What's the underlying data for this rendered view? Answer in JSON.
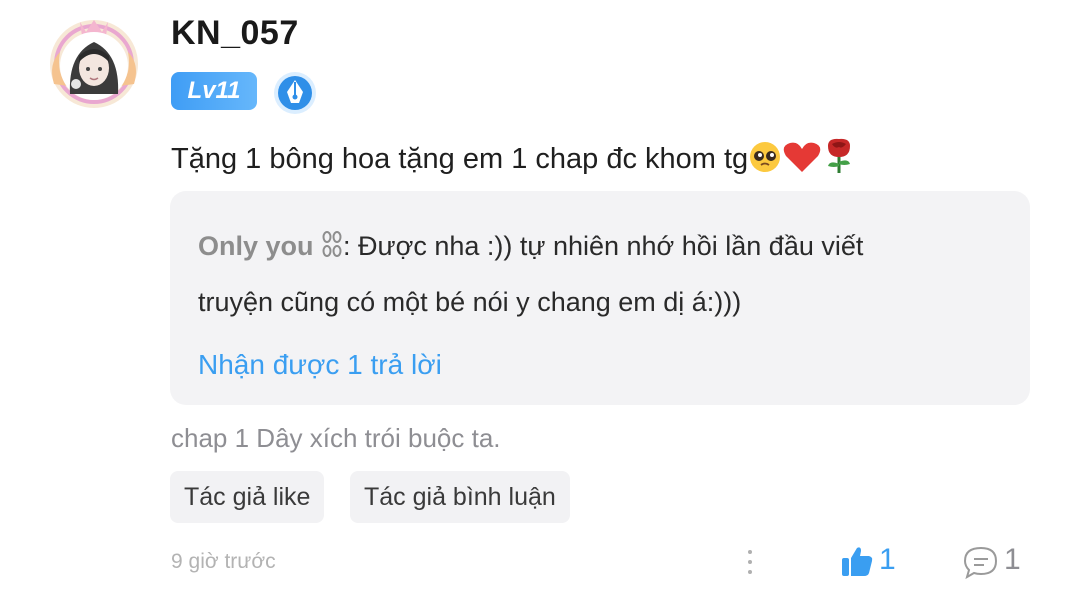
{
  "comment": {
    "username": "KN_057",
    "level_badge": "Lv11",
    "text": "Tặng 1 bông hoa tặng em 1 chap đc khom tg",
    "emojis": [
      "pleading-face",
      "red-heart",
      "rose"
    ]
  },
  "reply": {
    "author": "Only you",
    "author_emoji": "chain-links",
    "separator": ":",
    "text_line1": " Được nha :)) tự nhiên nhớ hồi lần đầu viết",
    "text_line2": "truyện cũng có một bé nói y chang em dị á:)))",
    "reply_count_text": "Nhận được 1 trả lời"
  },
  "chapter_info": "chap 1 Dây xích trói buộc ta.",
  "tags": [
    "Tác giả like",
    "Tác giả bình luận"
  ],
  "timestamp": "9 giờ trước",
  "actions": {
    "like_count": "1",
    "reply_count": "1"
  },
  "colors": {
    "accent": "#3a9ef1",
    "badge_blue": "#4aa8f7",
    "reply_bg": "#f3f3f5",
    "muted": "#8e8e93"
  }
}
